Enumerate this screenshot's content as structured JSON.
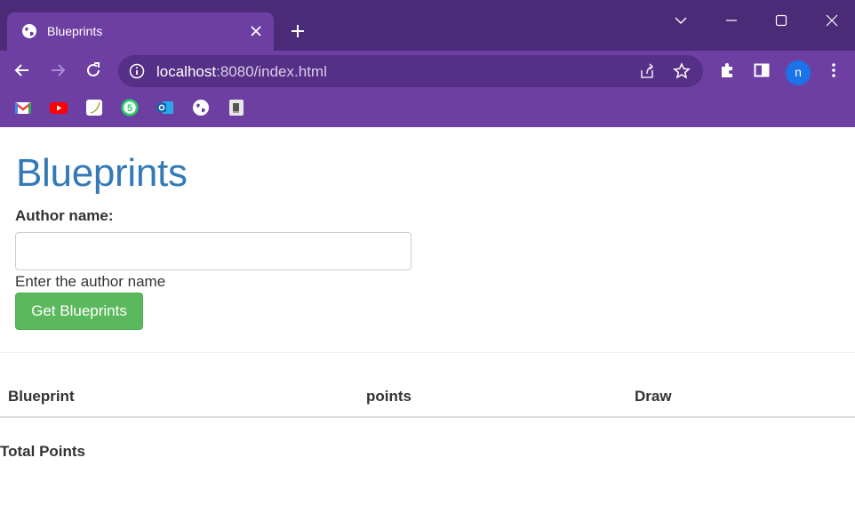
{
  "browser": {
    "tab": {
      "title": "Blueprints",
      "favicon": "globe-icon"
    },
    "address_bar": {
      "host": "localhost",
      "path": ":8080/index.html"
    },
    "profile_initial": "n",
    "bookmarks": [
      "gmail-icon",
      "youtube-icon",
      "notes-icon",
      "whatsapp-icon",
      "outlook-icon",
      "globe-icon",
      "document-icon"
    ],
    "colors": {
      "frame": "#4b2a78",
      "toolbar": "#6e3fa3",
      "omnibox": "#562f86"
    }
  },
  "page": {
    "heading": "Blueprints",
    "author_label": "Author name:",
    "author_input": {
      "value": "",
      "placeholder": ""
    },
    "help_text": "Enter the author name",
    "get_button": "Get Blueprints",
    "table": {
      "columns": [
        "Blueprint",
        "points",
        "Draw"
      ],
      "rows": []
    },
    "total_points_label": "Total Points",
    "colors": {
      "heading": "#337ab7",
      "button": "#5cb85c"
    }
  }
}
